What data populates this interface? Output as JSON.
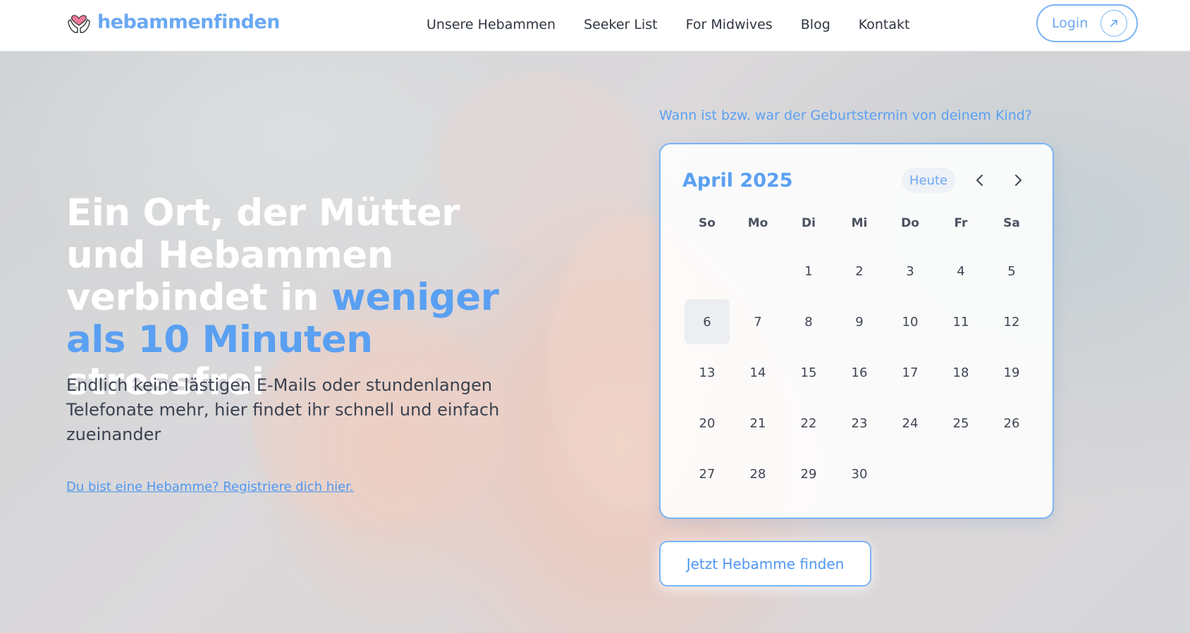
{
  "brand": {
    "name": "hebammenfinden",
    "color": "#6aa8f2"
  },
  "nav": {
    "items": [
      {
        "label": "Unsere Hebammen"
      },
      {
        "label": "Seeker List"
      },
      {
        "label": "For Midwives"
      },
      {
        "label": "Blog"
      },
      {
        "label": "Kontakt"
      }
    ],
    "login_label": "Login"
  },
  "hero": {
    "headline_part1": "Ein Ort, der Mütter und Hebammen verbindet in",
    "headline_accent": "weniger als 10 Minuten",
    "headline_part2": "stressfrei",
    "subtext": "Endlich keine lästigen E-Mails oder stundenlangen Telefonate mehr, hier findet ihr schnell und einfach zueinander",
    "register_link": "Du bist eine Hebamme? Registriere dich hier."
  },
  "calendar": {
    "question": "Wann ist bzw. war der Geburtstermin von deinem Kind?",
    "month_label": "April 2025",
    "today_label": "Heute",
    "weekdays": [
      "So",
      "Mo",
      "Di",
      "Mi",
      "Do",
      "Fr",
      "Sa"
    ],
    "leading_blanks": 2,
    "days_in_month": 30,
    "selected_day": 6
  },
  "cta": {
    "label": "Jetzt Hebamme finden"
  },
  "colors": {
    "accent": "#5aa0f2",
    "border": "#7ab4f5",
    "text_dark": "#2f3640"
  }
}
